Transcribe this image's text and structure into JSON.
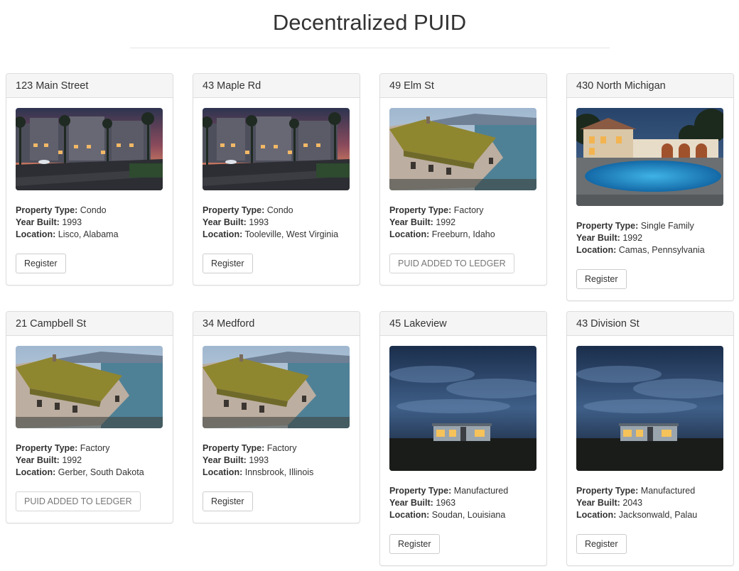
{
  "page": {
    "title": "Decentralized PUID"
  },
  "labels": {
    "type": "Property Type",
    "year": "Year Built",
    "location": "Location"
  },
  "properties": [
    {
      "name": "123 Main Street",
      "type": "Condo",
      "year": "1993",
      "location": "Lisco, Alabama",
      "button": "Register",
      "image": "condo"
    },
    {
      "name": "43 Maple Rd",
      "type": "Condo",
      "year": "1993",
      "location": "Tooleville, West Virginia",
      "button": "Register",
      "image": "condo"
    },
    {
      "name": "49 Elm St",
      "type": "Factory",
      "year": "1992",
      "location": "Freeburn, Idaho",
      "button": "PUID ADDED TO LEDGER",
      "image": "factory"
    },
    {
      "name": "430 North Michigan",
      "type": "Single Family",
      "year": "1992",
      "location": "Camas, Pennsylvania",
      "button": "Register",
      "image": "villa"
    },
    {
      "name": "21 Campbell St",
      "type": "Factory",
      "year": "1992",
      "location": "Gerber, South Dakota",
      "button": "PUID ADDED TO LEDGER",
      "image": "factory"
    },
    {
      "name": "34 Medford",
      "type": "Factory",
      "year": "1993",
      "location": "Innsbrook, Illinois",
      "button": "Register",
      "image": "factory"
    },
    {
      "name": "45 Lakeview",
      "type": "Manufactured",
      "year": "1963",
      "location": "Soudan, Louisiana",
      "button": "Register",
      "image": "night-house"
    },
    {
      "name": "43 Division St",
      "type": "Manufactured",
      "year": "2043",
      "location": "Jacksonwald, Palau",
      "button": "Register",
      "image": "night-house"
    }
  ]
}
